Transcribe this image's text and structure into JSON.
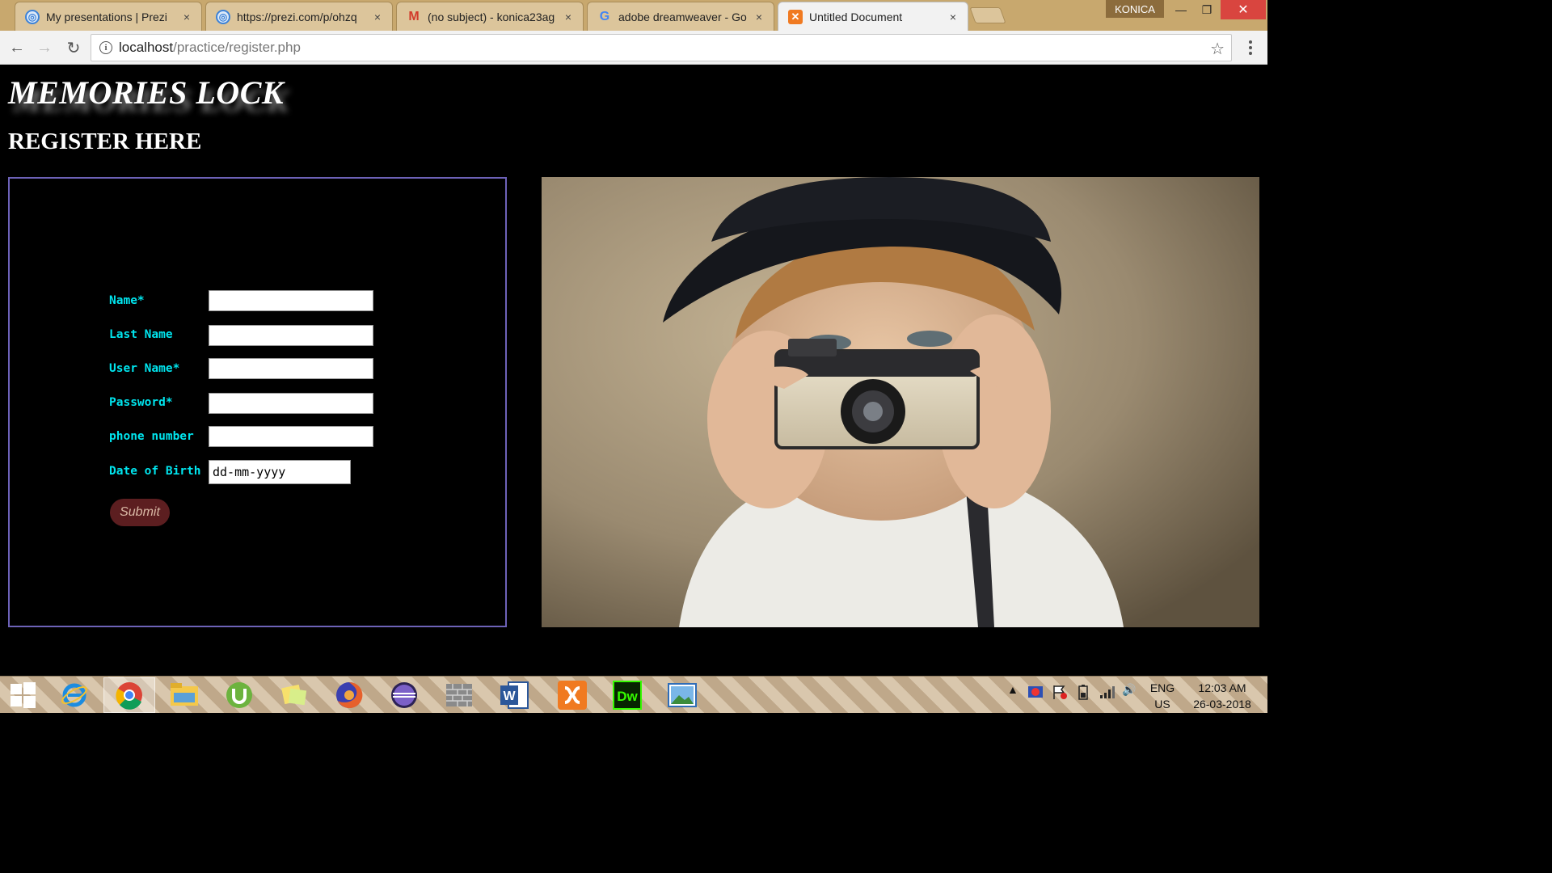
{
  "browser": {
    "tabs": [
      {
        "title": "My presentations | Prezi",
        "icon": "prezi-icon",
        "active": false
      },
      {
        "title": "https://prezi.com/p/ohzq",
        "icon": "prezi-icon",
        "active": false
      },
      {
        "title": "(no subject) - konica23ag",
        "icon": "gmail-icon",
        "active": false
      },
      {
        "title": "adobe dreamweaver - Go",
        "icon": "google-icon",
        "active": false
      },
      {
        "title": "Untitled Document",
        "icon": "xampp-icon",
        "active": true
      }
    ],
    "close_glyph": "×",
    "profile_name": "KONICA",
    "address": {
      "host": "localhost",
      "path": "/practice/register.php"
    }
  },
  "page": {
    "site_title": "MEMORIES LOCK",
    "heading": "REGISTER HERE",
    "form": {
      "fields": [
        {
          "label": "Name*",
          "value": ""
        },
        {
          "label": "Last Name",
          "value": ""
        },
        {
          "label": "User Name*",
          "value": ""
        },
        {
          "label": "Password*",
          "value": ""
        },
        {
          "label": "phone number",
          "value": ""
        }
      ],
      "dob": {
        "label": "Date of Birth",
        "value": "dd-mm-yyyy"
      },
      "submit_label": "Submit"
    },
    "image": {
      "alt": "child-with-camera-photo"
    },
    "colors": {
      "label": "#00e5ee",
      "form_border": "#6d62b8",
      "submit_bg": "#5c1e20",
      "submit_text": "#d9b8a5"
    }
  },
  "taskbar": {
    "apps": [
      "windows-start-icon",
      "internet-explorer-icon",
      "chrome-icon",
      "file-explorer-icon",
      "utorrent-icon",
      "sticky-notes-icon",
      "firefox-icon",
      "eclipse-icon",
      "bricks-icon",
      "word-icon",
      "xampp-icon",
      "dreamweaver-icon",
      "photos-icon"
    ],
    "lang_line1": "ENG",
    "lang_line2": "US",
    "time": "12:03 AM",
    "date": "26-03-2018"
  }
}
